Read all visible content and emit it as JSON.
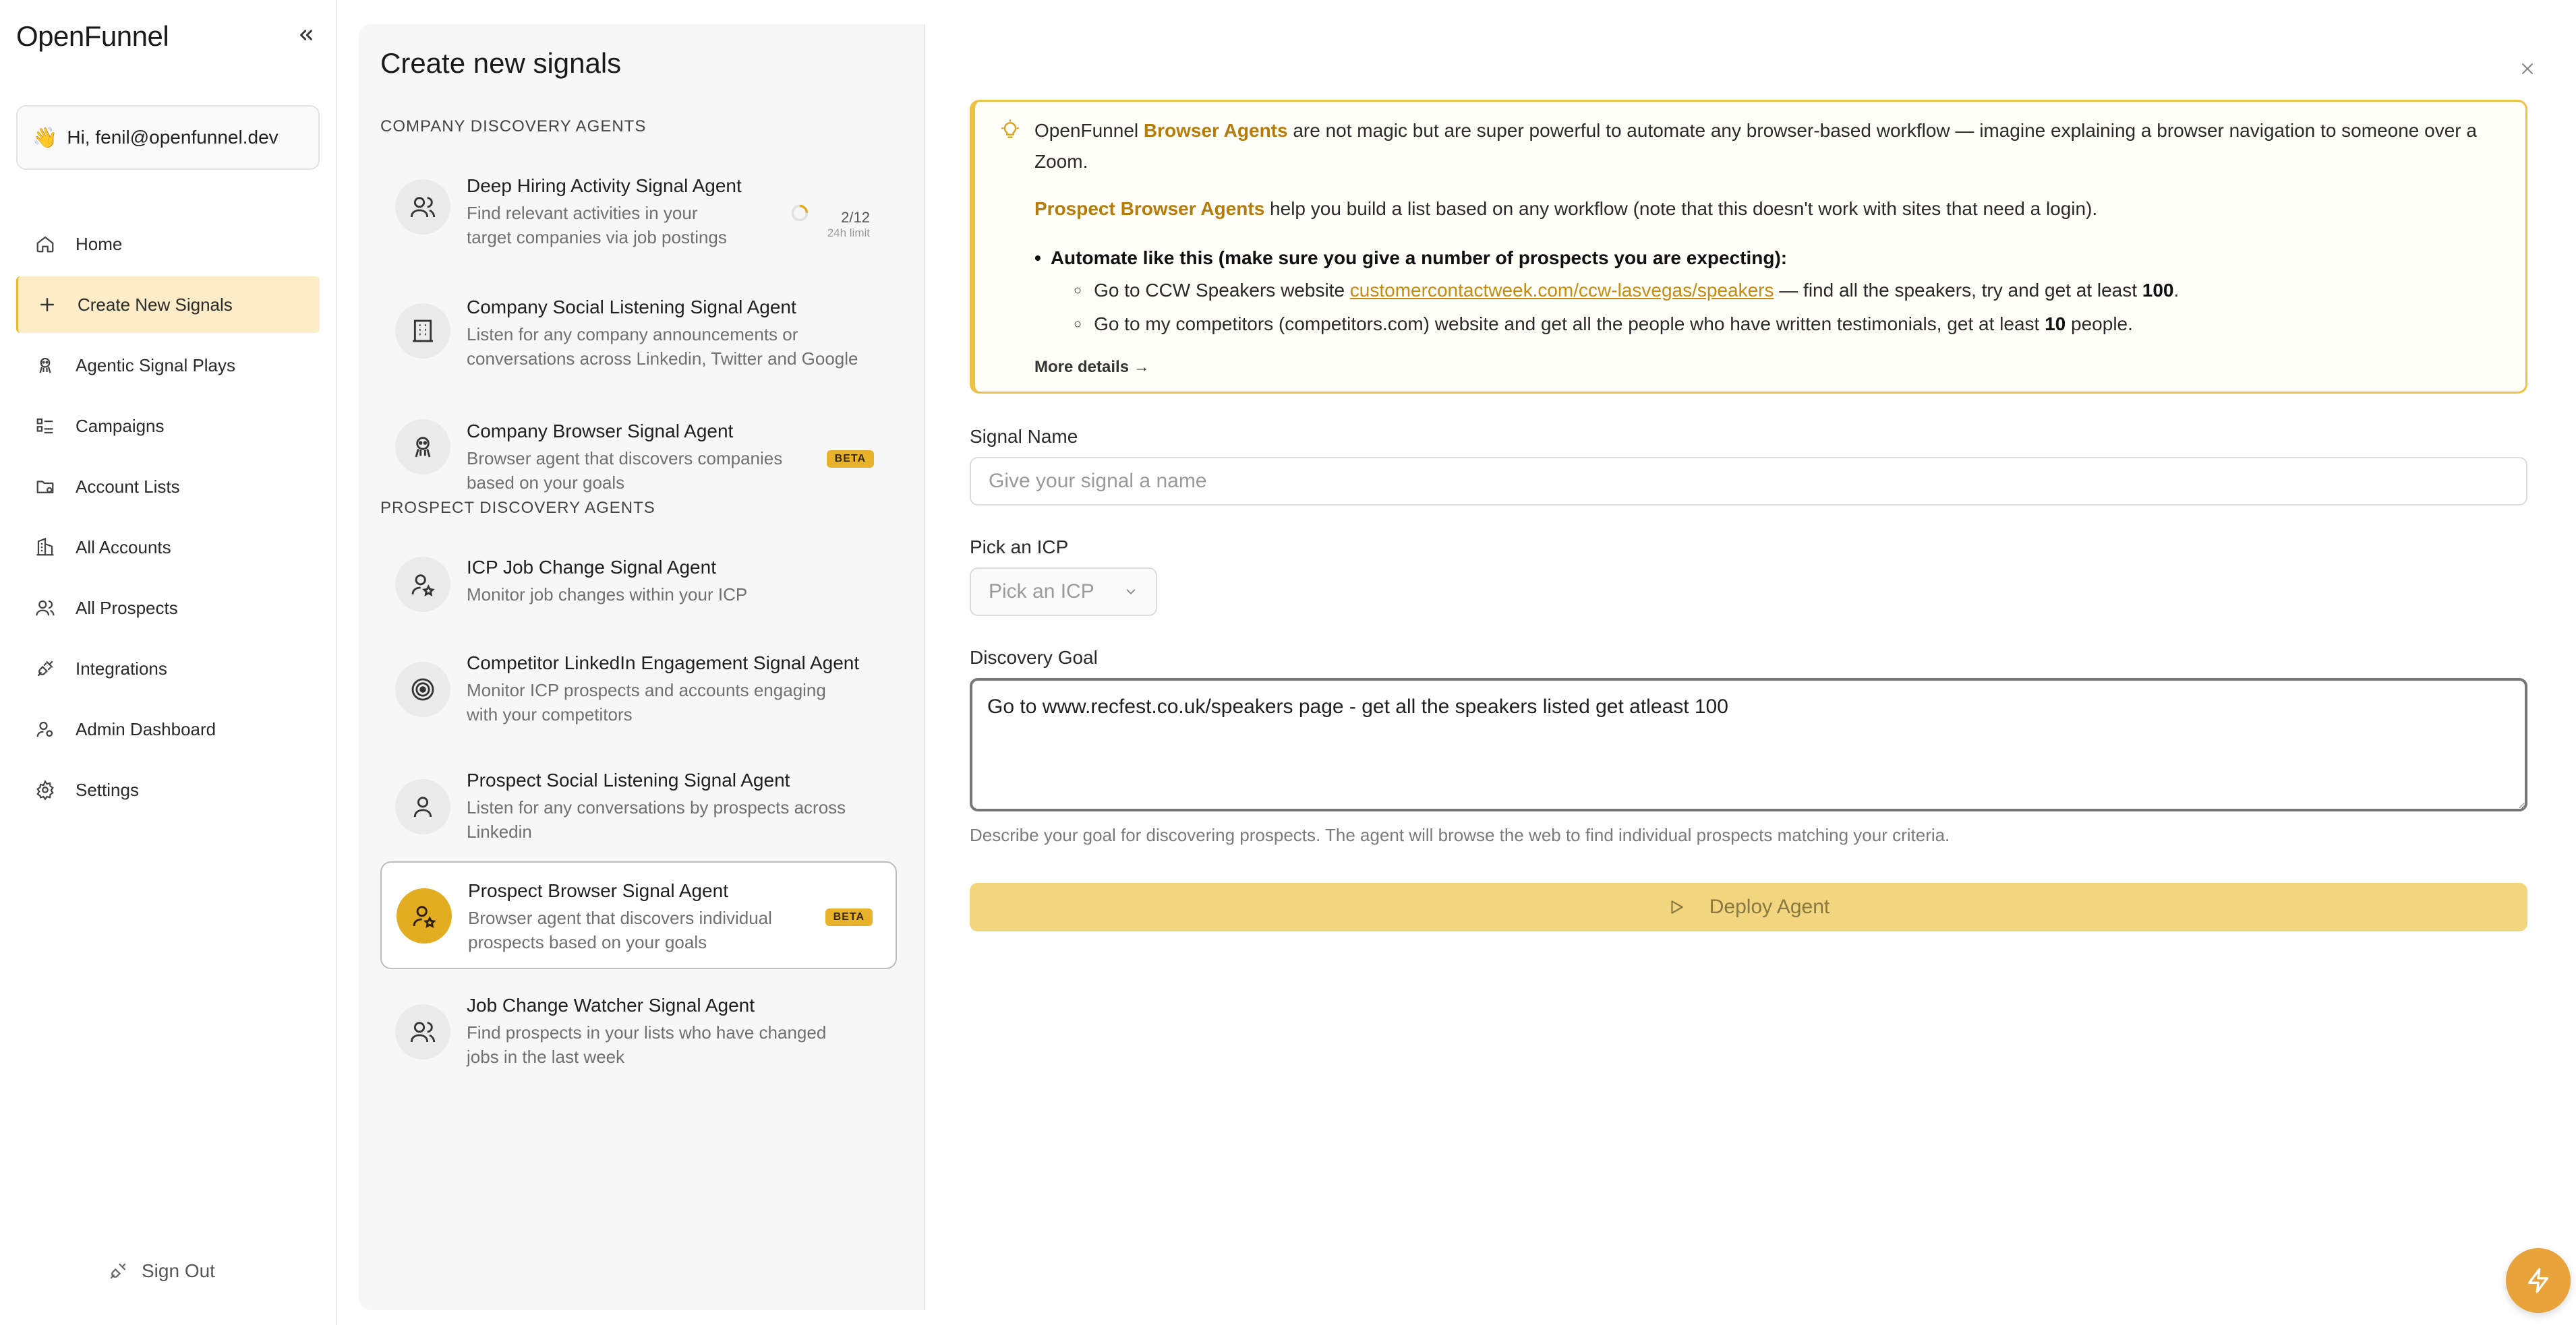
{
  "app": {
    "brand": "OpenFunnel"
  },
  "sidebar": {
    "user_greeting": "Hi, fenil@openfunnel.dev",
    "items": [
      {
        "label": "Home",
        "icon": "home-icon"
      },
      {
        "label": "Create New Signals",
        "icon": "plus-icon",
        "active": true
      },
      {
        "label": "Agentic Signal Plays",
        "icon": "robot-icon"
      },
      {
        "label": "Campaigns",
        "icon": "list-icon"
      },
      {
        "label": "Account Lists",
        "icon": "folder-icon"
      },
      {
        "label": "All Accounts",
        "icon": "building-icon"
      },
      {
        "label": "All Prospects",
        "icon": "users-icon"
      },
      {
        "label": "Integrations",
        "icon": "plug-icon"
      },
      {
        "label": "Admin Dashboard",
        "icon": "admin-user-icon"
      },
      {
        "label": "Settings",
        "icon": "gear-icon"
      }
    ],
    "sign_out": "Sign Out"
  },
  "agents_panel": {
    "title": "Create new signals",
    "company_section": "COMPANY DISCOVERY AGENTS",
    "prospect_section": "PROSPECT DISCOVERY AGENTS",
    "agents": [
      {
        "name": "Deep Hiring Activity Signal Agent",
        "desc1": "Find relevant activities in your",
        "desc2": "target companies via job postings",
        "limit": "2/12",
        "limit_sub": "24h limit"
      },
      {
        "name": "Company Social Listening Signal Agent",
        "desc1": "Listen for any company announcements or",
        "desc2": "conversations across Linkedin, Twitter and Google"
      },
      {
        "name": "Company Browser Signal Agent",
        "desc1": "Browser agent that discovers companies",
        "desc2": "based on your goals",
        "badge": "BETA"
      },
      {
        "name": "ICP Job Change Signal Agent",
        "desc1": "Monitor job changes within your ICP",
        "desc2": ""
      },
      {
        "name": "Competitor LinkedIn Engagement Signal Agent",
        "desc1": "Monitor ICP prospects and accounts engaging",
        "desc2": "with your competitors"
      },
      {
        "name": "Prospect Social Listening Signal Agent",
        "desc1": "Listen for any conversations by prospects across",
        "desc2": "Linkedin"
      },
      {
        "name": "Prospect Browser Signal Agent",
        "desc1": "Browser agent that discovers individual",
        "desc2": "prospects based on your goals",
        "badge": "BETA",
        "selected": true
      },
      {
        "name": "Job Change Watcher Signal Agent",
        "desc1": "Find prospects in your lists who have changed",
        "desc2": "jobs in the last week"
      }
    ]
  },
  "info": {
    "p1_a": "OpenFunnel ",
    "p1_hl": "Browser Agents",
    "p1_b": " are not magic but are super powerful to automate any browser-based workflow — imagine explaining a browser navigation to someone over a",
    "p1_c": "Zoom.",
    "p2_hl": "Prospect Browser Agents",
    "p2_b": " help you build a list based on any workflow (note that this doesn't work with sites that need a login).",
    "bullet": "Automate like this (make sure you give a number of prospects you are expecting):",
    "sub1_a": "Go to CCW Speakers website ",
    "sub1_link": "customercontactweek.com/ccw-lasvegas/speakers",
    "sub1_b": " — find all the speakers, try and get at least ",
    "sub1_num": "100",
    "sub1_c": ".",
    "sub2_a": "Go to my competitors (competitors.com) website and get all the people who have written testimonials, get at least ",
    "sub2_num": "10",
    "sub2_b": " people.",
    "more": "More details →"
  },
  "form": {
    "signal_name_label": "Signal Name",
    "signal_name_placeholder": "Give your signal a name",
    "icp_label": "Pick an ICP",
    "icp_value": "Pick an ICP",
    "goal_label": "Discovery Goal",
    "goal_value": "Go to www.recfest.co.uk/speakers page - get all the speakers listed get atleast 100",
    "helper": "Describe your goal for discovering prospects. The agent will browse the web to find individual prospects matching your criteria.",
    "deploy": "Deploy Agent"
  },
  "colors": {
    "accent": "#e3ad22",
    "active_nav_bg": "#fcecc7",
    "deploy_bg": "#f2d57f",
    "link": "#c68b10"
  }
}
